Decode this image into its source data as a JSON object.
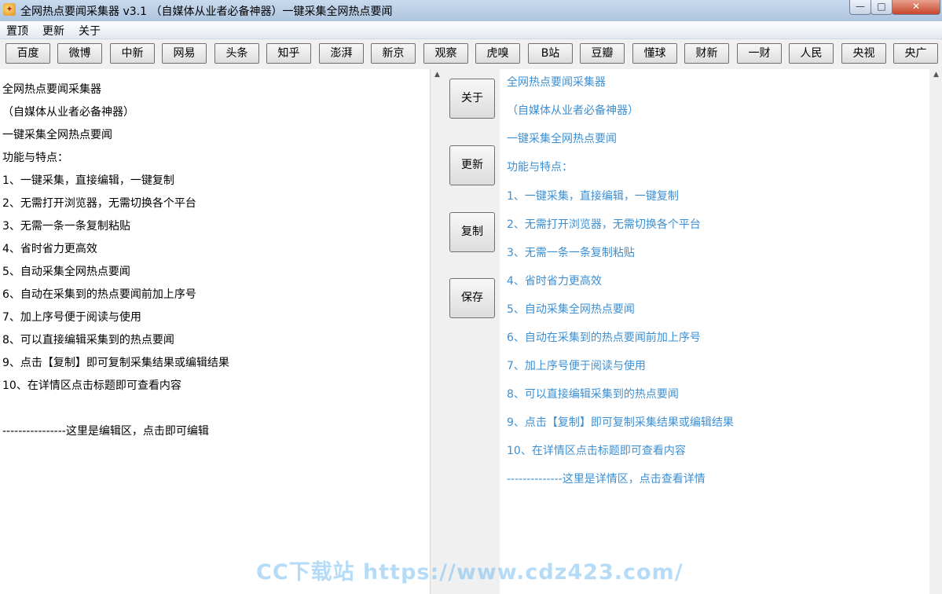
{
  "window": {
    "title": "全网热点要闻采集器  v3.1  （自媒体从业者必备神器）一键采集全网热点要闻",
    "icon_glyph": "✦",
    "min_glyph": "—",
    "max_glyph": "□",
    "close_glyph": "✕"
  },
  "menu": [
    "置顶",
    "更新",
    "关于"
  ],
  "sources": [
    "百度",
    "微博",
    "中新",
    "网易",
    "头条",
    "知乎",
    "澎湃",
    "新京",
    "观察",
    "虎嗅",
    "B站",
    "豆瓣",
    "懂球",
    "财新",
    "一财",
    "人民",
    "央视",
    "央广"
  ],
  "actions": {
    "about": "关于",
    "update": "更新",
    "copy": "复制",
    "save": "保存"
  },
  "editor": {
    "lines": [
      "全网热点要闻采集器",
      "（自媒体从业者必备神器）",
      "一键采集全网热点要闻",
      "功能与特点：",
      "1、一键采集，直接编辑，一键复制",
      "2、无需打开浏览器，无需切换各个平台",
      "3、无需一条一条复制粘贴",
      "4、省时省力更高效",
      "5、自动采集全网热点要闻",
      "6、自动在采集到的热点要闻前加上序号",
      "7、加上序号便于阅读与使用",
      "8、可以直接编辑采集到的热点要闻",
      "9、点击【复制】即可复制采集结果或编辑结果",
      "10、在详情区点击标题即可查看内容"
    ],
    "footer": "----------------这里是编辑区，点击即可编辑"
  },
  "detail": {
    "lines": [
      "全网热点要闻采集器",
      "（自媒体从业者必备神器）",
      "一键采集全网热点要闻",
      "功能与特点：",
      "1、一键采集，直接编辑，一键复制",
      "2、无需打开浏览器，无需切换各个平台",
      "3、无需一条一条复制粘贴",
      "4、省时省力更高效",
      "5、自动采集全网热点要闻",
      "6、自动在采集到的热点要闻前加上序号",
      "7、加上序号便于阅读与使用",
      "8、可以直接编辑采集到的热点要闻",
      "9、点击【复制】即可复制采集结果或编辑结果",
      "10、在详情区点击标题即可查看内容",
      "--------------这里是详情区，点击查看详情"
    ],
    "link_color": "#3d8fd1"
  },
  "watermark": "CC下载站 https://www.cdz423.com/"
}
